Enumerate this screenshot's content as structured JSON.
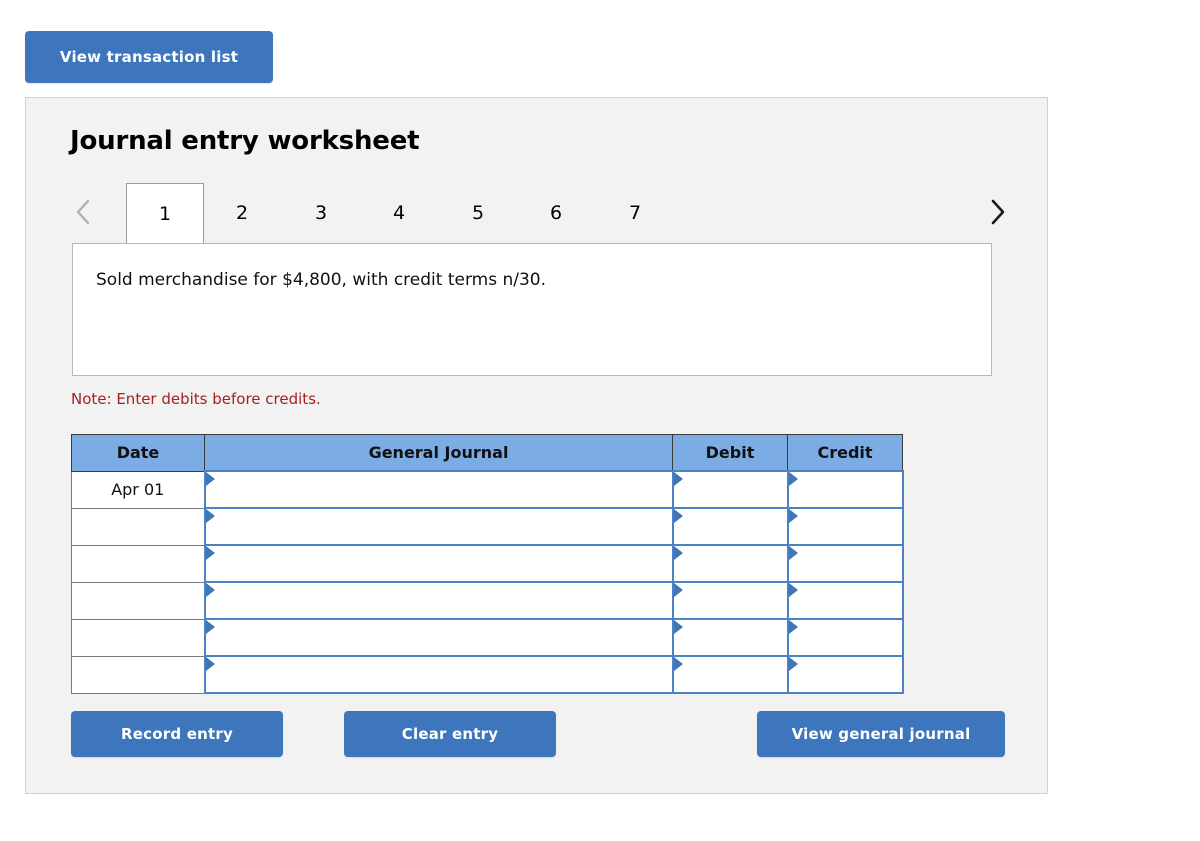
{
  "top": {
    "view_transaction_list_label": "View transaction list"
  },
  "worksheet": {
    "title": "Journal entry worksheet",
    "prev_icon": "chevron-left-icon",
    "next_icon": "chevron-right-icon",
    "tabs": [
      {
        "label": "1",
        "active": true
      },
      {
        "label": "2",
        "active": false
      },
      {
        "label": "3",
        "active": false
      },
      {
        "label": "4",
        "active": false
      },
      {
        "label": "5",
        "active": false
      },
      {
        "label": "6",
        "active": false
      },
      {
        "label": "7",
        "active": false
      }
    ],
    "transaction_description": "Sold merchandise for $4,800, with credit terms n/30.",
    "note": "Note: Enter debits before credits.",
    "table": {
      "headers": [
        "Date",
        "General Journal",
        "Debit",
        "Credit"
      ],
      "rows": [
        {
          "date": "Apr 01",
          "general_journal": "",
          "debit": "",
          "credit": ""
        },
        {
          "date": "",
          "general_journal": "",
          "debit": "",
          "credit": ""
        },
        {
          "date": "",
          "general_journal": "",
          "debit": "",
          "credit": ""
        },
        {
          "date": "",
          "general_journal": "",
          "debit": "",
          "credit": ""
        },
        {
          "date": "",
          "general_journal": "",
          "debit": "",
          "credit": ""
        },
        {
          "date": "",
          "general_journal": "",
          "debit": "",
          "credit": ""
        }
      ]
    },
    "buttons": {
      "record_entry": "Record entry",
      "clear_entry": "Clear entry",
      "view_general_journal": "View general journal"
    }
  },
  "colors": {
    "button_blue": "#3d76bc",
    "header_blue": "#7cace4",
    "field_border_blue": "#4a82c3",
    "note_red": "#a72020",
    "panel_gray": "#f2f2f2"
  }
}
